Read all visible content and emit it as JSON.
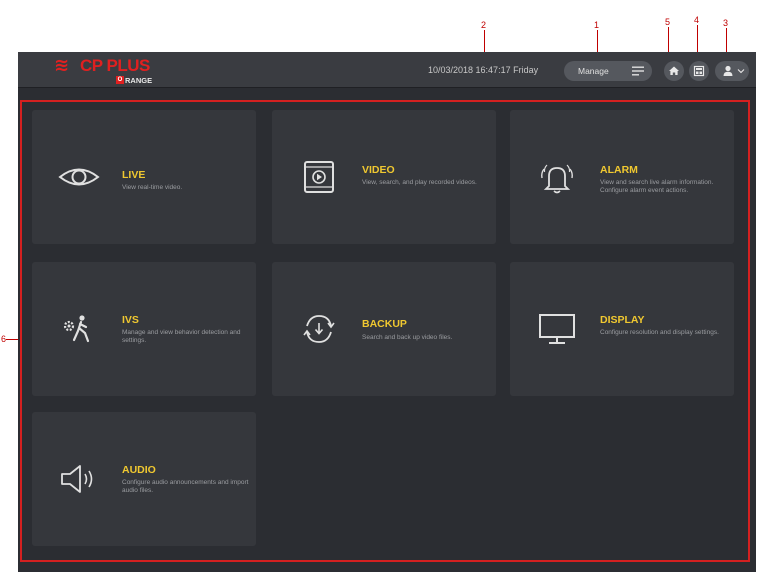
{
  "callouts": {
    "c1": "1",
    "c2": "2",
    "c3": "3",
    "c4": "4",
    "c5": "5",
    "c6": "6"
  },
  "header": {
    "logo_mark": "≋",
    "logo_brand": "CP PLUS",
    "logo_sub_letter": "O",
    "logo_sub_rest": "RANGE",
    "datetime": "10/03/2018 16:47:17 Friday",
    "manage_label": "Manage"
  },
  "icons": {
    "manage": "list-icon",
    "home": "home-icon",
    "layout": "layout-icon",
    "user": "user-icon",
    "chevron": "chevron-down-icon"
  },
  "colors": {
    "accent_title": "#f0c830",
    "brand_red": "#e02020",
    "frame_red": "#d42020",
    "background": "#2b2d32",
    "tile": "#35373c"
  },
  "menu": {
    "live": {
      "title": "LIVE",
      "desc": "View real-time video."
    },
    "video": {
      "title": "VIDEO",
      "desc": "View, search, and play recorded videos."
    },
    "alarm": {
      "title": "ALARM",
      "desc": "View and search live alarm information. Configure alarm event actions."
    },
    "ivs": {
      "title": "IVS",
      "desc": "Manage and view behavior detection and settings."
    },
    "backup": {
      "title": "BACKUP",
      "desc": "Search and back up video files."
    },
    "display": {
      "title": "DISPLAY",
      "desc": "Configure resolution and display settings."
    },
    "audio": {
      "title": "AUDIO",
      "desc": "Configure audio announcements and import audio files."
    }
  }
}
